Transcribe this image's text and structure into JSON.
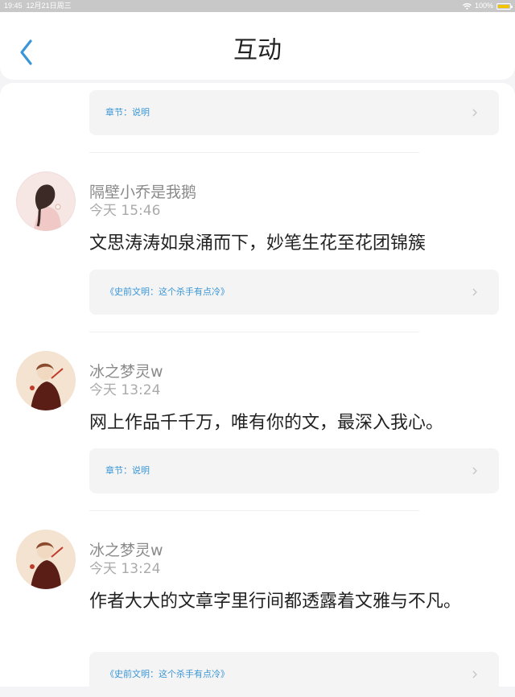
{
  "status": {
    "time": "19:45",
    "date": "12月21日周三",
    "battery": "100%",
    "battery_level": 1.0
  },
  "nav": {
    "title": "互动",
    "back_icon": "chevron-left-icon"
  },
  "accent": "#3a96d6",
  "top_card": {
    "link": "章节：说明"
  },
  "comments": [
    {
      "user": "隔壁小乔是我鹅",
      "time": "今天 15:46",
      "text": "文思涛涛如泉涌而下，妙笔生花至花团锦簇",
      "link": "《史前文明：这个杀手有点冷》"
    },
    {
      "user": "冰之梦灵w",
      "time": "今天 13:24",
      "text": "网上作品千千万，唯有你的文，最深入我心。",
      "link": "章节：说明"
    },
    {
      "user": "冰之梦灵w",
      "time": "今天 13:24",
      "text": "作者大大的文章字里行间都透露着文雅与不凡。",
      "link": "《史前文明：这个杀手有点冷》"
    }
  ]
}
